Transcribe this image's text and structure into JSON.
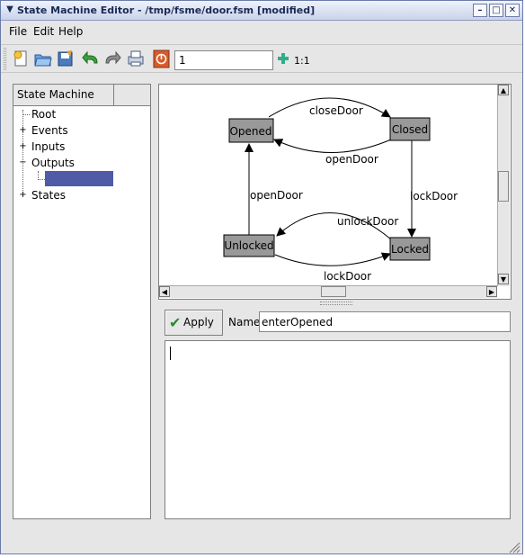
{
  "window": {
    "title": "State Machine Editor - /tmp/fsme/door.fsm [modified]",
    "menu_icon": "chevron-down-icon",
    "buttons": [
      "minimize-icon",
      "maximize-icon",
      "close-icon"
    ]
  },
  "menubar": {
    "items": [
      {
        "label": "File",
        "mnemonic": "F"
      },
      {
        "label": "Edit",
        "mnemonic": "E"
      },
      {
        "label": "Help",
        "mnemonic": "H"
      }
    ]
  },
  "toolbar": {
    "zoom_value": "1",
    "zoom_reset_label": "1:1",
    "icons": [
      "new-file-icon",
      "open-folder-icon",
      "save-icon",
      "undo-icon",
      "redo-icon",
      "print-icon",
      "stop-icon",
      "zoom-in-icon"
    ]
  },
  "tree": {
    "header": "State Machine",
    "items": [
      {
        "label": "Root",
        "expandable": false
      },
      {
        "label": "Events",
        "expandable": true,
        "expanded": false
      },
      {
        "label": "Inputs",
        "expandable": true,
        "expanded": false
      },
      {
        "label": "Outputs",
        "expandable": true,
        "expanded": true
      },
      {
        "label": "",
        "selected": true
      },
      {
        "label": "States",
        "expandable": true,
        "expanded": false
      }
    ]
  },
  "diagram": {
    "states": [
      "Opened",
      "Closed",
      "Unlocked",
      "Locked"
    ],
    "transitions": [
      {
        "label": "closeDoor",
        "from": "Opened",
        "to": "Closed"
      },
      {
        "label": "openDoor",
        "from": "Closed",
        "to": "Opened"
      },
      {
        "label": "lockDoor",
        "from": "Closed",
        "to": "Locked"
      },
      {
        "label": "unlockDoor",
        "from": "Locked",
        "to": "Unlocked"
      },
      {
        "label": "lockDoor",
        "from": "Unlocked",
        "to": "Locked"
      },
      {
        "label": "openDoor",
        "from": "Unlocked",
        "to": "Opened"
      }
    ],
    "state_fill": "#999999"
  },
  "properties": {
    "apply_label": "Apply",
    "name_label": "Name",
    "name_mnemonic": "a",
    "name_value": "enterOpened",
    "editor_text": ""
  },
  "colors": {
    "selection": "#4f5ba7",
    "titlebar": "#c9d3ea"
  }
}
